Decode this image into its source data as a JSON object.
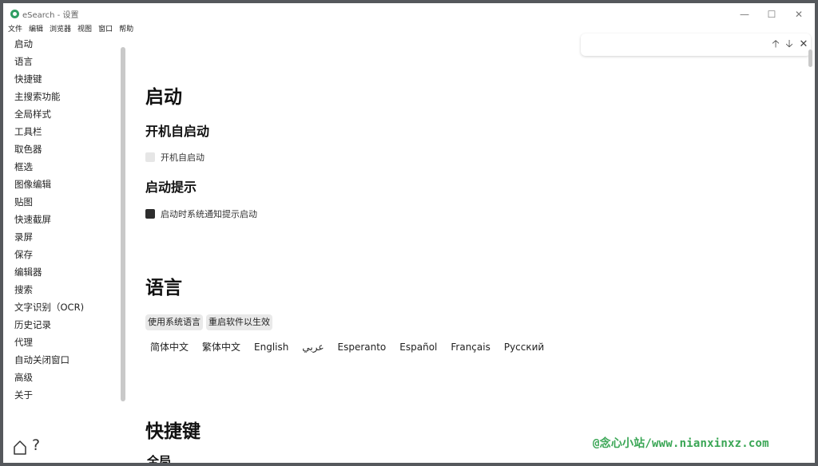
{
  "window": {
    "title": "eSearch - 设置",
    "controls": {
      "minimize": "—",
      "maximize": "☐",
      "close": "✕"
    }
  },
  "menu": [
    "文件",
    "编辑",
    "浏览器",
    "视图",
    "窗口",
    "帮助"
  ],
  "sidebar": {
    "items": [
      "启动",
      "语言",
      "快捷键",
      "主搜索功能",
      "全局样式",
      "工具栏",
      "取色器",
      "框选",
      "图像编辑",
      "贴图",
      "快速截屏",
      "录屏",
      "保存",
      "编辑器",
      "搜索",
      "文字识别（OCR)",
      "历史记录",
      "代理",
      "自动关闭窗口",
      "高级",
      "关于"
    ],
    "help_label": "?"
  },
  "main": {
    "startup": {
      "title": "启动",
      "autostart_heading": "开机自启动",
      "autostart_label": "开机自启动",
      "autostart_checked": false,
      "tip_heading": "启动提示",
      "tip_label": "启动时系统通知提示启动",
      "tip_checked": true
    },
    "language": {
      "title": "语言",
      "buttons": [
        "使用系统语言",
        "重启软件以生效"
      ],
      "options": [
        "简体中文",
        "繁体中文",
        "English",
        "عربي",
        "Esperanto",
        "Español",
        "Français",
        "Русский"
      ]
    },
    "shortcuts": {
      "title": "快捷键",
      "partial_heading": "全局"
    }
  },
  "findbar": {
    "up": "🡡",
    "down": "🡣",
    "close": "✕"
  },
  "watermark": "@念心小站/www.nianxinxz.com",
  "colors": {
    "accent_check": "#2d2d2d",
    "watermark": "#3aa655"
  }
}
